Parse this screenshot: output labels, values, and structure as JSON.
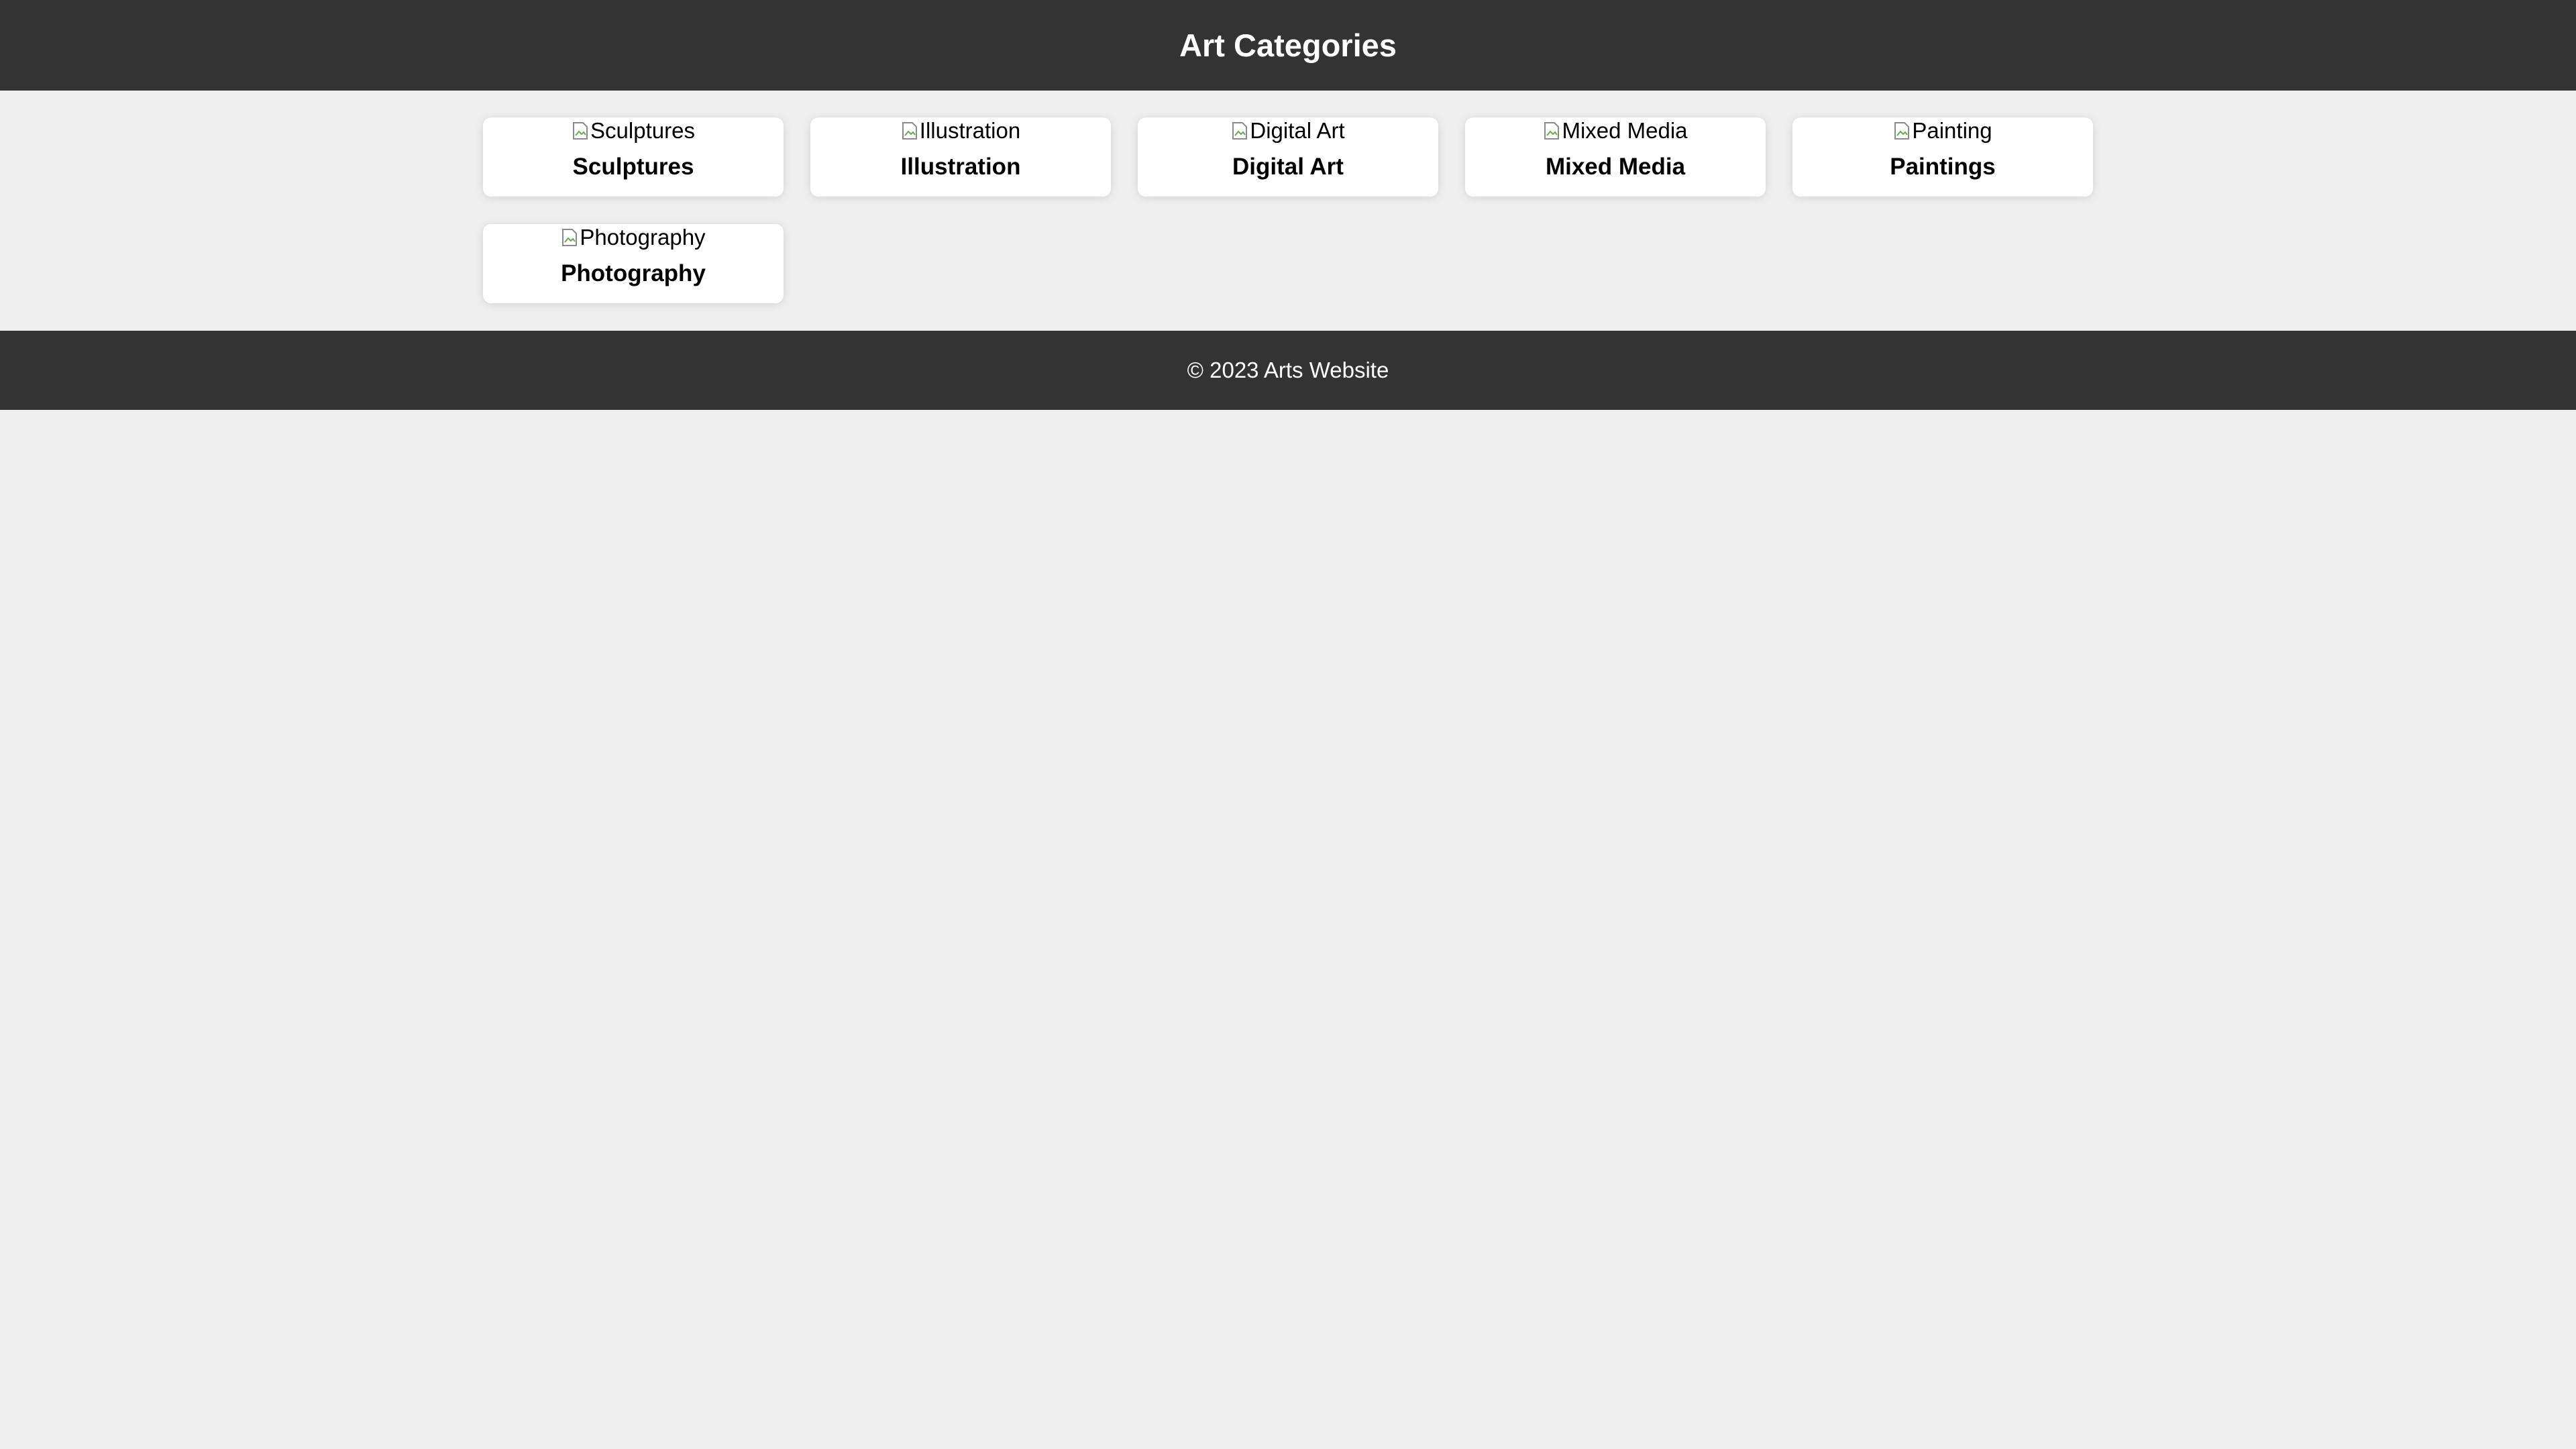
{
  "header": {
    "title": "Art Categories"
  },
  "categories": [
    {
      "alt": "Sculptures",
      "title": "Sculptures"
    },
    {
      "alt": "Illustration",
      "title": "Illustration"
    },
    {
      "alt": "Digital Art",
      "title": "Digital Art"
    },
    {
      "alt": "Mixed Media",
      "title": "Mixed Media"
    },
    {
      "alt": "Painting",
      "title": "Paintings"
    },
    {
      "alt": "Photography",
      "title": "Photography"
    }
  ],
  "footer": {
    "text": "© 2023 Arts Website"
  },
  "colors": {
    "bar": "#333333",
    "background": "#efefef",
    "card": "#ffffff"
  }
}
